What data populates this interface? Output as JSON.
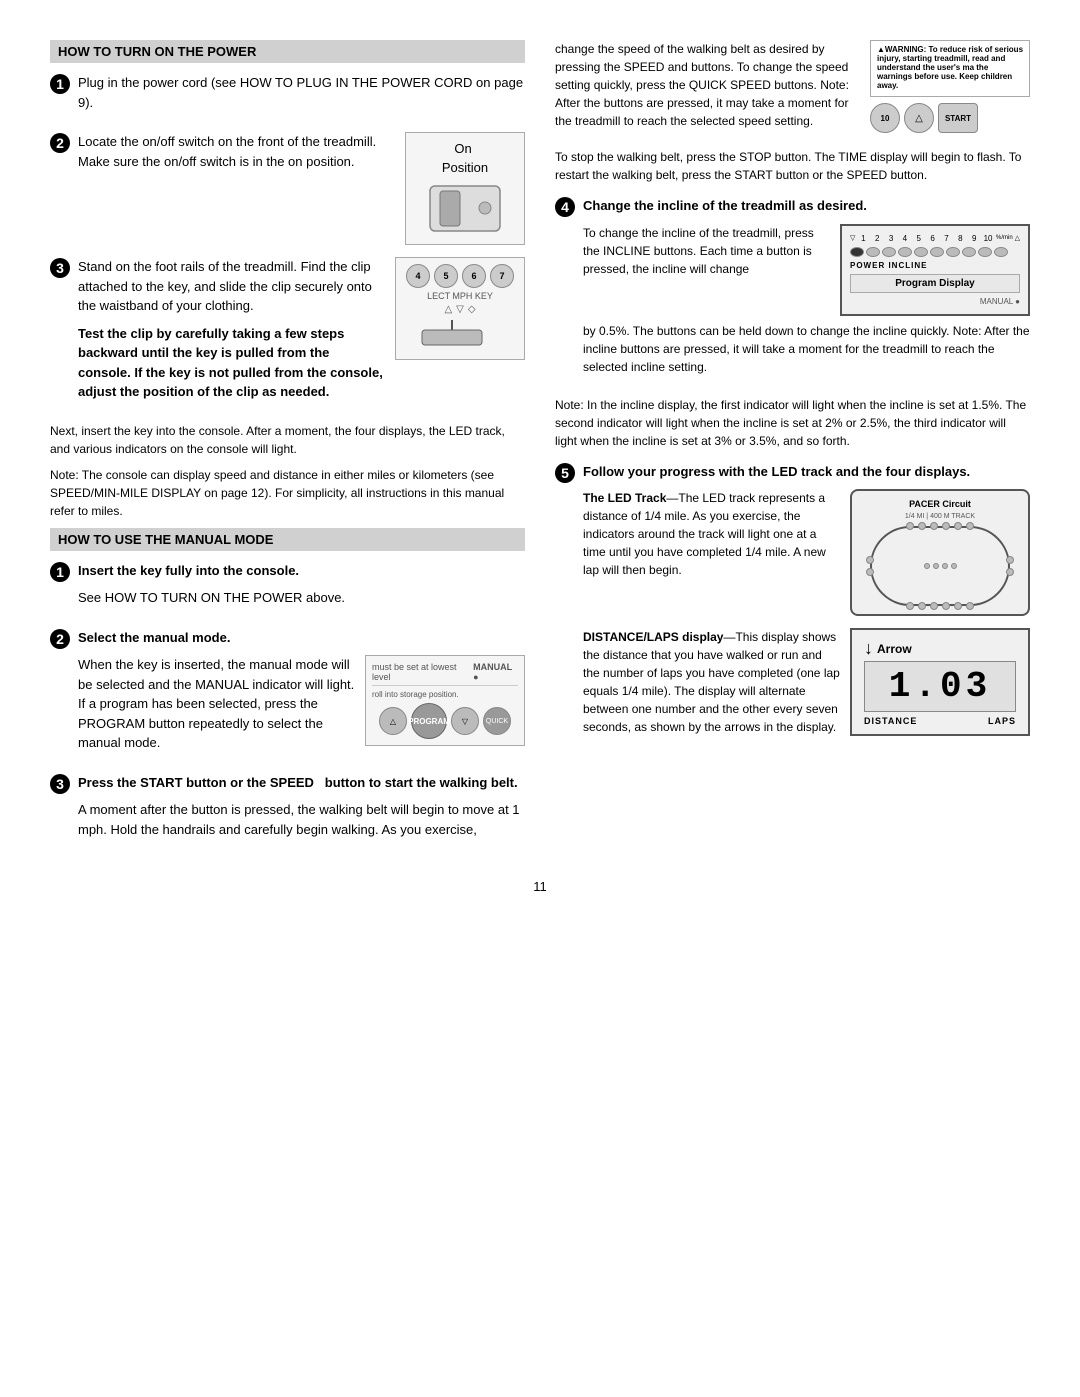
{
  "page": {
    "number": "11"
  },
  "sections": {
    "how_to_turn_on": {
      "title": "HOW TO TURN ON THE POWER",
      "steps": [
        {
          "num": "1",
          "text": "Plug in the power cord (see HOW TO PLUG IN THE POWER CORD on page 9)."
        },
        {
          "num": "2",
          "text": "Locate the on/off switch on the front of the treadmill. Make sure the on/off switch is in the on position.",
          "image_label": "On Position"
        },
        {
          "num": "3",
          "text": "Stand on the foot rails of the treadmill. Find the clip attached to the key, and slide the clip securely onto the waistband of your clothing.",
          "bold_text": "Test the clip by carefully taking a few steps backward until the key is pulled from the console. If the key is not pulled from the console, adjust the position of the clip as needed."
        }
      ],
      "paragraph1": "Next, insert the key into the console. After a moment, the four displays, the LED track, and various indicators on the console will light.",
      "paragraph2": "Note: The console can display speed and distance in either miles or kilometers (see SPEED/MIN-MILE DISPLAY on page 12). For simplicity, all instructions in this manual refer to miles."
    },
    "manual_mode": {
      "title": "HOW TO USE THE MANUAL MODE",
      "steps": [
        {
          "num": "1",
          "title": "Insert the key fully into the console.",
          "text": "See HOW TO TURN ON THE POWER above."
        },
        {
          "num": "2",
          "title": "Select the manual mode.",
          "text": "When the key is inserted, the manual mode will be selected and the MANUAL indicator will light. If a program has been selected, press the PROGRAM button repeatedly to select the manual mode."
        },
        {
          "num": "3",
          "title": "Press the START button or the SPEED   button to start the walking belt.",
          "text": "A moment after the button is pressed, the walking belt will begin to move at 1 mph. Hold the handrails and carefully begin walking. As you exercise,"
        }
      ]
    },
    "right_column": {
      "speed_paragraph": "change the speed of the walking belt as desired by pressing the SPEED and   buttons. To change the speed setting quickly, press the QUICK SPEED buttons. Note: After the buttons are pressed, it may take a moment for the treadmill to reach the selected speed setting.",
      "stop_paragraph": "To stop the walking belt, press the STOP button. The TIME display will begin to flash. To restart the walking belt, press the START button or the SPEED   button.",
      "step4": {
        "num": "4",
        "title": "Change the incline of the treadmill as desired.",
        "text1": "To change the incline of the treadmill, press the INCLINE buttons. Each time a button is pressed, the incline will change by 0.5%. The buttons can be held down to change the incline quickly. Note: After the incline buttons are pressed, it will take a moment for the treadmill to reach the selected incline setting."
      },
      "incline_note": "Note: In the incline display, the first indicator will light when the incline is set at 1.5%. The second indicator will light when the incline is set at 2% or 2.5%, the third indicator will light when the incline is set at 3% or 3.5%, and so forth.",
      "step5": {
        "num": "5",
        "title": "Follow your progress with the LED track and the four displays.",
        "led_track_title": "The LED Track",
        "led_track_text": "The LED track represents a distance of 1/4 mile. As you exercise, the indicators around the track will light one at a time until you have completed 1/4 mile. A new lap will then begin.",
        "distance_title": "DISTANCE/LAPS display",
        "distance_text": "This display shows the distance that you have walked or run and the number of laps you have completed (one lap equals 1/4 mile). The display will alternate between one number and the other every seven seconds, as shown by the arrows in the display."
      }
    }
  },
  "images": {
    "on_position": {
      "label": "On",
      "sublabel": "Position"
    },
    "incline_display": {
      "numbers": [
        "1",
        "2",
        "3",
        "4",
        "5",
        "6",
        "7",
        "8",
        "9",
        "10",
        "%/min"
      ],
      "label": "POWER INCLINE",
      "program_display": "Program Display",
      "manual_label": "MANUAL"
    },
    "distance_display": {
      "arrow_label": "Arrow",
      "number": "1.03",
      "distance_label": "DISTANCE",
      "laps_label": "LAPS"
    },
    "manual_console": {
      "top_text1": "must be set at lowest level",
      "top_text2": "MANUAL",
      "top_text3": "roll into storage position.",
      "btn_left": "▽",
      "btn_program": "PROGRAM",
      "btn_right": "▽",
      "btn_quick": "QUICK"
    }
  }
}
